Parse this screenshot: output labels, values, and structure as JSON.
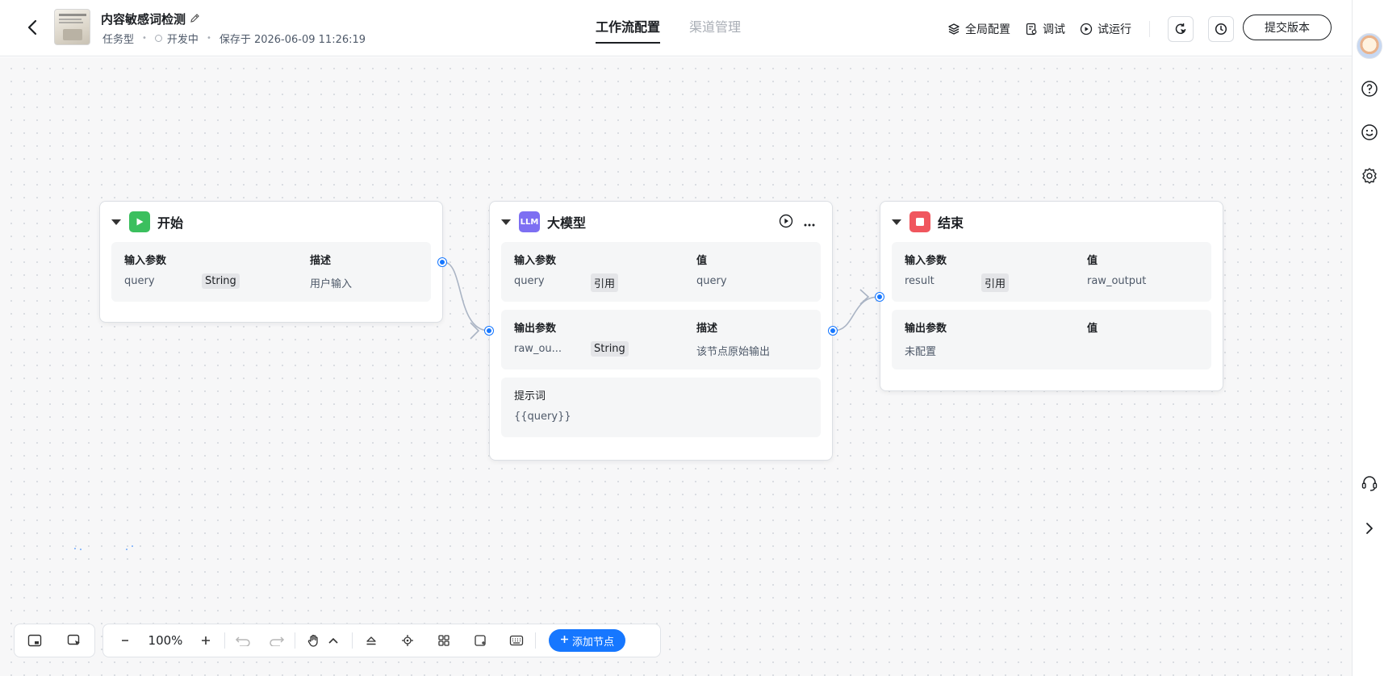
{
  "header": {
    "title": "内容敏感词检测",
    "type_label": "任务型",
    "status_label": "开发中",
    "saved_label": "保存于 2026-06-09 11:26:19",
    "tabs": [
      {
        "label": "工作流配置",
        "active": true
      },
      {
        "label": "渠道管理",
        "active": false
      }
    ],
    "actions": {
      "global_config": "全局配置",
      "debug": "调试",
      "trial_run": "试运行",
      "submit": "提交版本"
    }
  },
  "nodes": {
    "start": {
      "title": "开始",
      "icon": "play-icon",
      "color": "#3bbf5e",
      "input_section": {
        "col1": "输入参数",
        "col2": "描述",
        "rows": [
          {
            "name": "query",
            "type": "String",
            "value": "用户输入"
          }
        ]
      }
    },
    "llm": {
      "title": "大模型",
      "icon_text": "LLM",
      "color": "#7d6ff2",
      "input_section": {
        "col1": "输入参数",
        "col2": "值",
        "rows": [
          {
            "name": "query",
            "type": "引用",
            "value": "query"
          }
        ]
      },
      "output_section": {
        "col1": "输出参数",
        "col2": "描述",
        "rows": [
          {
            "name": "raw_ou...",
            "type": "String",
            "value": "该节点原始输出"
          }
        ]
      },
      "prompt_section": {
        "label": "提示词",
        "value": "{{query}}"
      }
    },
    "end": {
      "title": "结束",
      "icon": "stop-icon",
      "color": "#f0565e",
      "input_section": {
        "col1": "输入参数",
        "col2": "值",
        "rows": [
          {
            "name": "result",
            "type": "引用",
            "value": "raw_output"
          }
        ]
      },
      "output_section": {
        "col1": "输出参数",
        "col2": "值",
        "placeholder": "未配置"
      }
    }
  },
  "toolbar": {
    "zoom": "100%",
    "add_node": "添加节点"
  },
  "colors": {
    "accent": "#1677ff",
    "edge": "#aab4c4"
  }
}
